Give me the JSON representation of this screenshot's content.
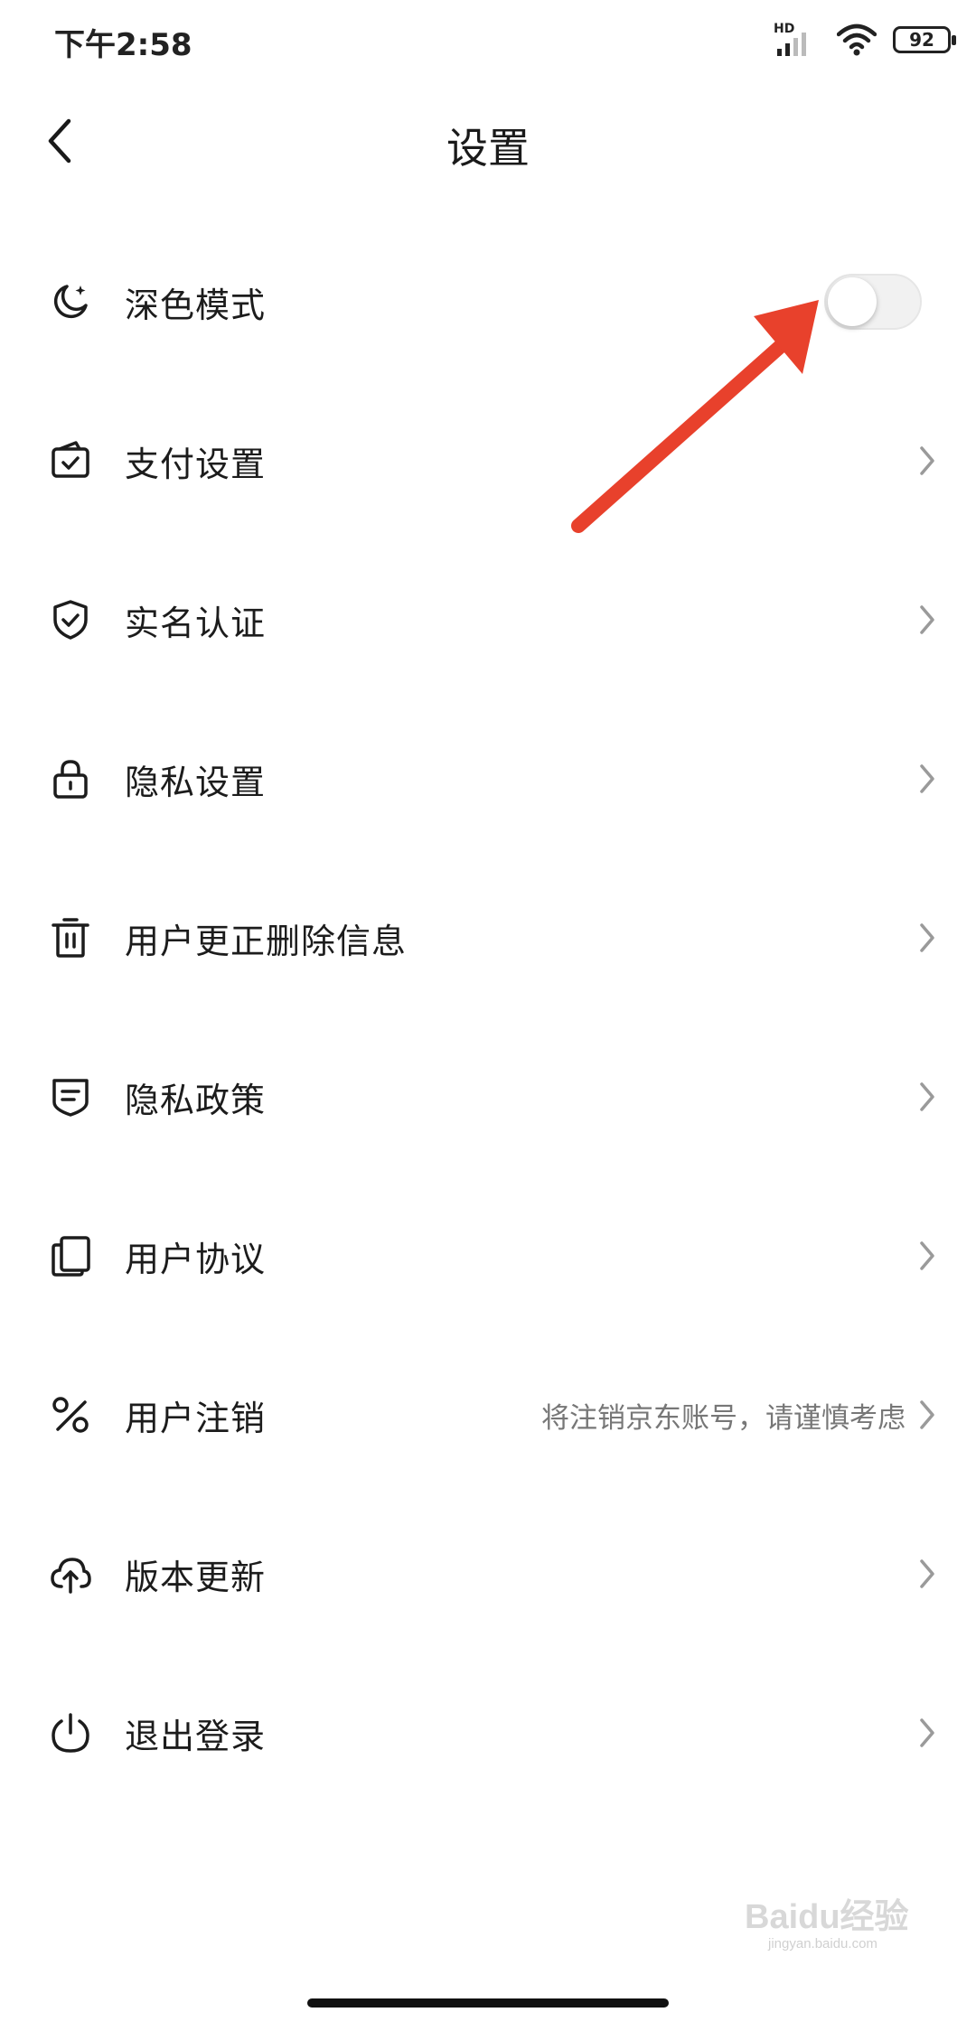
{
  "status_bar": {
    "time": "下午2:58",
    "network": "HD",
    "battery": "92"
  },
  "header": {
    "title": "设置"
  },
  "settings": [
    {
      "label": "深色模式",
      "icon": "moon-icon",
      "control": "toggle",
      "toggle_on": false
    },
    {
      "label": "支付设置",
      "icon": "wallet-check-icon",
      "control": "chevron"
    },
    {
      "label": "实名认证",
      "icon": "shield-check-icon",
      "control": "chevron"
    },
    {
      "label": "隐私设置",
      "icon": "lock-icon",
      "control": "chevron"
    },
    {
      "label": "用户更正删除信息",
      "icon": "trash-icon",
      "control": "chevron"
    },
    {
      "label": "隐私政策",
      "icon": "document-shield-icon",
      "control": "chevron"
    },
    {
      "label": "用户协议",
      "icon": "copy-document-icon",
      "control": "chevron"
    },
    {
      "label": "用户注销",
      "icon": "unlink-icon",
      "control": "chevron",
      "sublabel": "将注销京东账号，请谨慎考虑"
    },
    {
      "label": "版本更新",
      "icon": "cloud-upload-icon",
      "control": "chevron"
    },
    {
      "label": "退出登录",
      "icon": "power-icon",
      "control": "chevron"
    }
  ],
  "colors": {
    "annotation_arrow": "#e8412c",
    "text": "#1c1c1c",
    "subtext": "#777777"
  },
  "watermark": {
    "logo_text": "Baidu经验",
    "url": "jingyan.baidu.com"
  }
}
